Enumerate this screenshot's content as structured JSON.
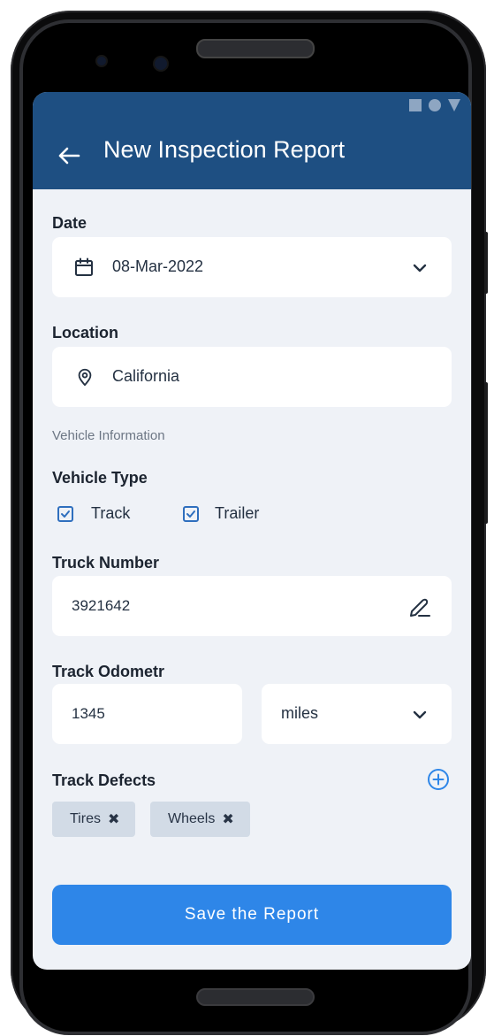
{
  "header": {
    "title": "New Inspection Report"
  },
  "form": {
    "date_label": "Date",
    "date_value": "08-Mar-2022",
    "location_label": "Location",
    "location_value": "California",
    "vehicle_info_label": "Vehicle Information",
    "vehicle_type_label": "Vehicle Type",
    "vehicle_types": [
      {
        "label": "Track",
        "checked": true
      },
      {
        "label": "Trailer",
        "checked": true
      }
    ],
    "truck_number_label": "Truck Number",
    "truck_number_value": "3921642",
    "odometer_label": "Track Odometr",
    "odometer_value": "1345",
    "odometer_unit": "miles",
    "defects_label": "Track Defects",
    "defects": [
      "Tires",
      "Wheels"
    ],
    "chip_remove_glyph": "✖"
  },
  "actions": {
    "save_label": "Save the Report"
  },
  "colors": {
    "appbar": "#1e4f82",
    "accent": "#2e86e8",
    "screen_bg": "#eff2f7"
  }
}
